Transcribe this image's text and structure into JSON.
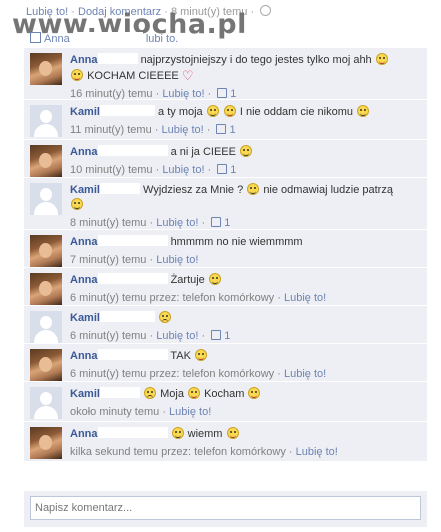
{
  "top": {
    "like_label": "Lubię to!",
    "add_comment_label": "Dodaj komentarz",
    "time": "8 minut(y) temu",
    "watermark": "www.wiocha.pl",
    "post_author": "Anna",
    "post_likes_text": "lubi to."
  },
  "comments": [
    {
      "author": "Anna",
      "redact_w": 40,
      "text_pre": "najprzystojniejszy i do tego jestes tylko moj ahh",
      "text_line2": "KOCHAM CIEEEE",
      "time": "16 minut(y) temu",
      "like": "Lubię to!",
      "likes": "1",
      "avatar": "photo"
    },
    {
      "author": "Kamil",
      "redact_w": 55,
      "text_pre": "a ty moja",
      "text_mid": "I nie oddam cie nikomu",
      "time": "11 minut(y) temu",
      "like": "Lubię to!",
      "likes": "1",
      "avatar": "blank"
    },
    {
      "author": "Anna",
      "redact_w": 70,
      "text_pre": "a ni ja CIEEE",
      "time": "10 minut(y) temu",
      "like": "Lubię to!",
      "likes": "1",
      "avatar": "photo"
    },
    {
      "author": "Kamil",
      "redact_w": 40,
      "text_pre": "Wyjdziesz za Mnie ?",
      "text_mid": "nie odmawiaj ludzie patrzą",
      "time": "8 minut(y) temu",
      "like": "Lubię to!",
      "likes": "1",
      "avatar": "blank"
    },
    {
      "author": "Anna",
      "redact_w": 70,
      "text_pre": "hmmmm no nie wiemmmm",
      "time": "7 minut(y) temu",
      "like": "Lubię to!",
      "avatar": "photo"
    },
    {
      "author": "Anna",
      "redact_w": 70,
      "text_pre": "Żartuje",
      "time": "6 minut(y) temu przez: telefon komórkowy",
      "like": "Lubię to!",
      "avatar": "photo"
    },
    {
      "author": "Kamil",
      "redact_w": 55,
      "text_pre": "",
      "time": "6 minut(y) temu",
      "like": "Lubię to!",
      "likes": "1",
      "avatar": "blank"
    },
    {
      "author": "Anna",
      "redact_w": 70,
      "text_pre": "TAK",
      "time": "6 minut(y) temu przez: telefon komórkowy",
      "like": "Lubię to!",
      "avatar": "photo"
    },
    {
      "author": "Kamil",
      "redact_w": 40,
      "text_pre": "Moja",
      "text_mid": "Kocham",
      "time": "około minuty temu",
      "like": "Lubię to!",
      "avatar": "blank"
    },
    {
      "author": "Anna",
      "redact_w": 70,
      "text_pre": "wiemm",
      "time": "kilka sekund temu przez: telefon komórkowy",
      "like": "Lubię to!",
      "avatar": "photo"
    }
  ],
  "input": {
    "placeholder": "Napisz komentarz..."
  }
}
